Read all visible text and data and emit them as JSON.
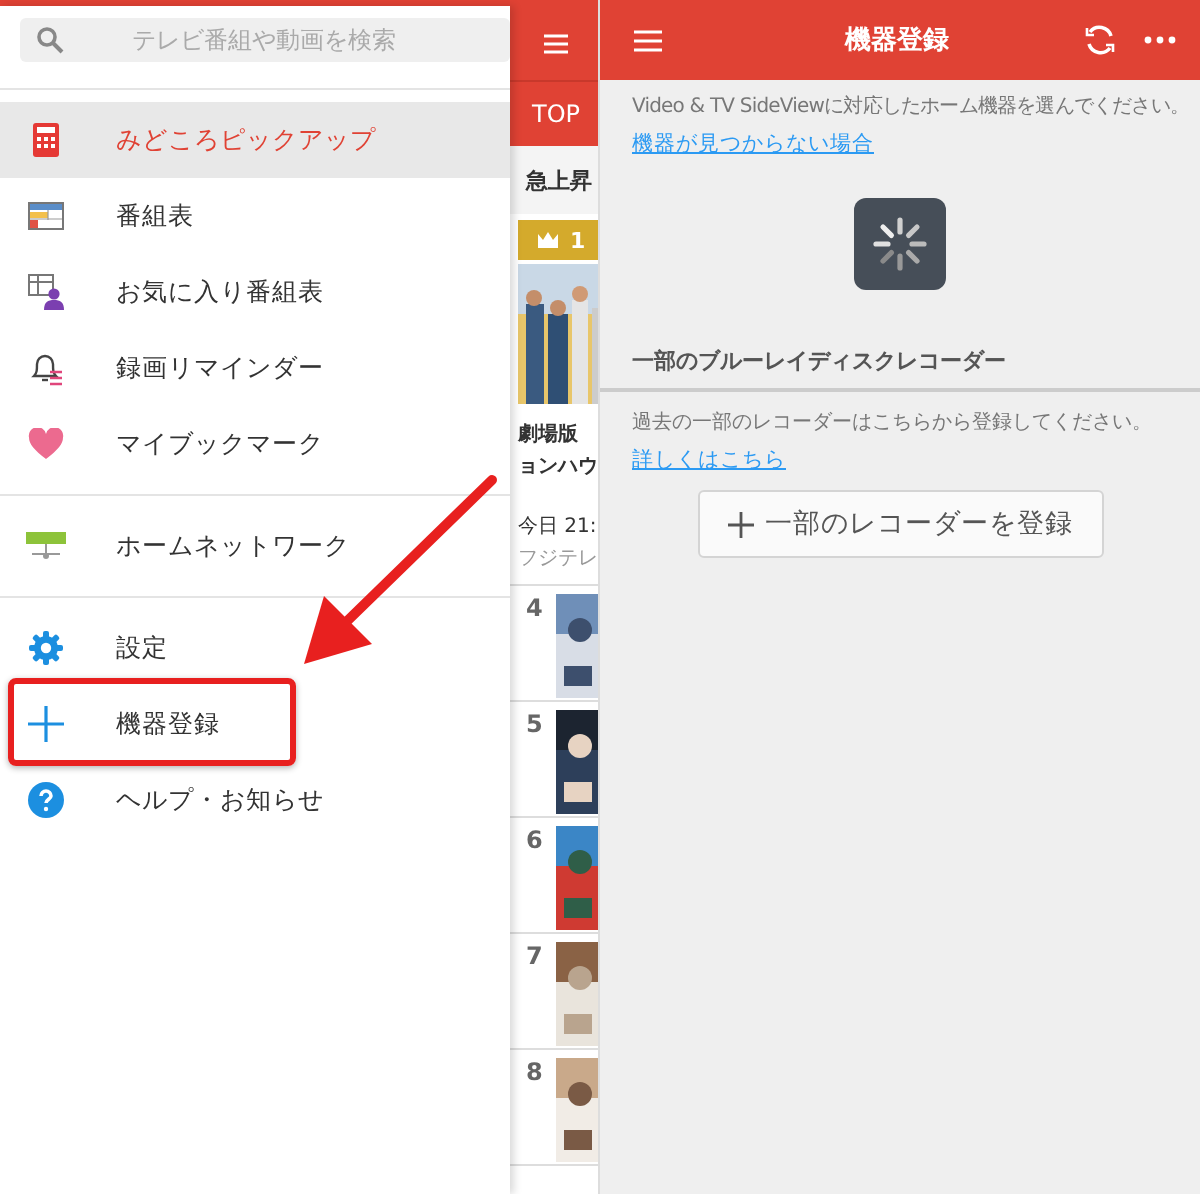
{
  "left_screen": {
    "drawer": {
      "search": {
        "placeholder": "テレビ番組や動画を検索"
      },
      "groups": [
        [
          {
            "label": "みどころピックアップ",
            "selected": true,
            "highlighted": false
          },
          {
            "label": "番組表",
            "selected": false,
            "highlighted": false
          },
          {
            "label": "お気に入り番組表",
            "selected": false,
            "highlighted": false
          },
          {
            "label": "録画リマインダー",
            "selected": false,
            "highlighted": false
          },
          {
            "label": "マイブックマーク",
            "selected": false,
            "highlighted": false
          }
        ],
        [
          {
            "label": "ホームネットワーク",
            "selected": false,
            "highlighted": false
          }
        ],
        [
          {
            "label": "設定",
            "selected": false,
            "highlighted": false
          },
          {
            "label": "機器登録",
            "selected": false,
            "highlighted": true
          },
          {
            "label": "ヘルプ・お知らせ",
            "selected": false,
            "highlighted": false
          }
        ]
      ]
    },
    "behind": {
      "tab": "TOP",
      "section_title": "急上昇",
      "rank_badge": "1",
      "feature_title_lines": [
        "劇場版",
        "ョンハウ"
      ],
      "feature_time": "今日 21:",
      "feature_channel": "フジテレ",
      "ranks": [
        "4",
        "5",
        "6",
        "7",
        "8"
      ]
    }
  },
  "right_screen": {
    "title": "機器登録",
    "intro": "Video & TV SideViewに対応したホーム機器を選んでください。",
    "help_link": "機器が見つからない場合",
    "section_title": "一部のブルーレイディスクレコーダー",
    "section_text": "過去の一部のレコーダーはこちらから登録してください。",
    "detail_link": "詳しくはこちら",
    "register_button": "一部のレコーダーを登録"
  }
}
